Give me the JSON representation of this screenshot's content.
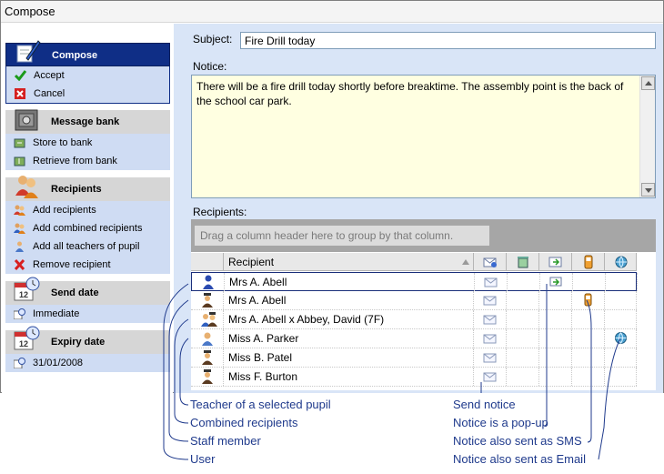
{
  "window": {
    "title": "Compose"
  },
  "sidebar": {
    "groups": [
      {
        "title": "Compose",
        "items": [
          "Accept",
          "Cancel"
        ]
      },
      {
        "title": "Message bank",
        "items": [
          "Store to bank",
          "Retrieve from bank"
        ]
      },
      {
        "title": "Recipients",
        "items": [
          "Add recipients",
          "Add combined recipients",
          "Add all teachers of pupil",
          "Remove recipient"
        ]
      },
      {
        "title": "Send date",
        "items": [
          "Immediate"
        ]
      },
      {
        "title": "Expiry date",
        "items": [
          "31/01/2008"
        ]
      }
    ]
  },
  "form": {
    "subject_label": "Subject:",
    "subject_value": "Fire Drill today",
    "notice_label": "Notice:",
    "notice_value": "There will be a fire drill today shortly before breaktime. The assembly point is the back of the school car park.",
    "recipients_label": "Recipients:"
  },
  "grid": {
    "group_hint": "Drag a column header here to group by that column.",
    "columns": {
      "recipient": "Recipient"
    },
    "column_icons": [
      "send-notice-icon",
      "delete-icon",
      "popup-icon",
      "sms-phone-icon",
      "email-globe-icon"
    ],
    "rows": [
      {
        "icon": "user-icon",
        "name": "Mrs A. Abell",
        "popup": true,
        "sms": false,
        "email": false
      },
      {
        "icon": "staff-member-icon",
        "name": "Mrs A. Abell",
        "popup": false,
        "sms": true,
        "email": false
      },
      {
        "icon": "combined-recipients-icon",
        "name": "Mrs A. Abell x Abbey, David (7F)",
        "popup": false,
        "sms": false,
        "email": false
      },
      {
        "icon": "teacher-of-pupil-icon",
        "name": "Miss A. Parker",
        "popup": false,
        "sms": false,
        "email": true
      },
      {
        "icon": "staff-member-icon",
        "name": "Miss B. Patel",
        "popup": false,
        "sms": false,
        "email": false
      },
      {
        "icon": "staff-member-icon",
        "name": "Miss F. Burton",
        "popup": false,
        "sms": false,
        "email": false
      }
    ]
  },
  "annotations": {
    "left": [
      "Teacher of a selected pupil",
      "Combined recipients",
      "Staff member",
      "User"
    ],
    "right": [
      "Send notice",
      "Notice is a pop-up",
      "Notice also sent as SMS",
      "Notice also sent as Email"
    ]
  },
  "colors": {
    "active_group": "#0f2e86",
    "item_bg": "#cfdcf3",
    "main_bg": "#d9e5f7",
    "notice_bg": "#ffffe1",
    "annotation": "#1f3a8c"
  }
}
